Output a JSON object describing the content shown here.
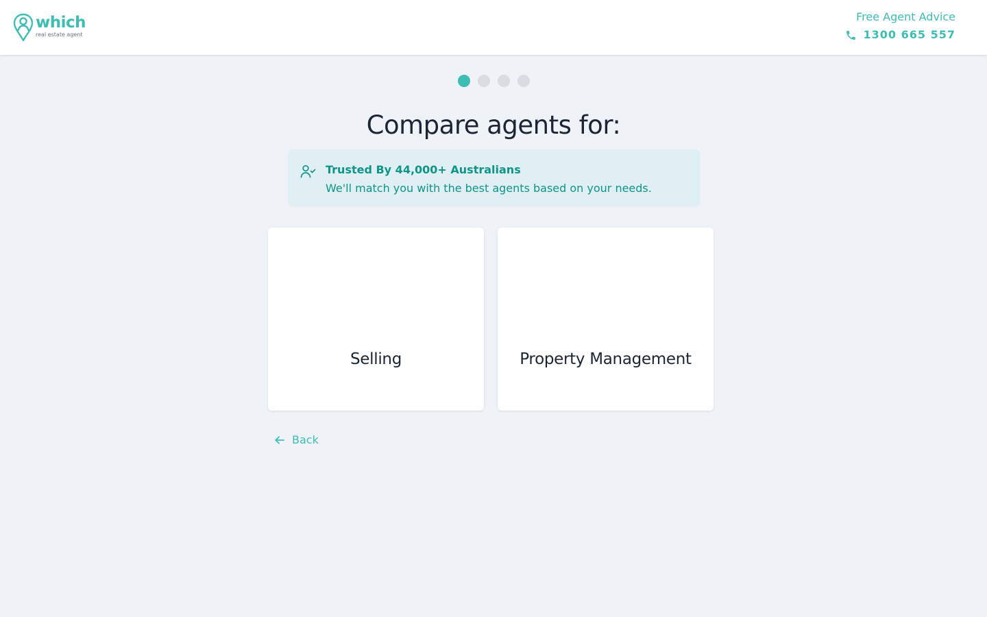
{
  "header": {
    "logo": {
      "word": "which",
      "subtitle": "real estate agent",
      "icon": "map-pin-person-icon"
    },
    "advice_label": "Free Agent Advice",
    "phone_icon": "phone-icon",
    "phone_number": "1300 665 557"
  },
  "progress": {
    "current_step": 1,
    "total_steps": 4
  },
  "page_title": "Compare agents for:",
  "trust": {
    "icon": "user-check-icon",
    "title": "Trusted By 44,000+ Australians",
    "text": "We'll match you with the best agents based on your needs."
  },
  "options": [
    {
      "label": "Selling"
    },
    {
      "label": "Property Management"
    }
  ],
  "back": {
    "icon": "arrow-left-icon",
    "label": "Back"
  },
  "colors": {
    "brand": "#3dbdb4",
    "brand_dark": "#0f9488",
    "background": "#eff3f8",
    "card": "#ffffff",
    "trust_bg": "#e0eff3",
    "dot_inactive": "#d9dde3",
    "text": "#1c2536"
  }
}
